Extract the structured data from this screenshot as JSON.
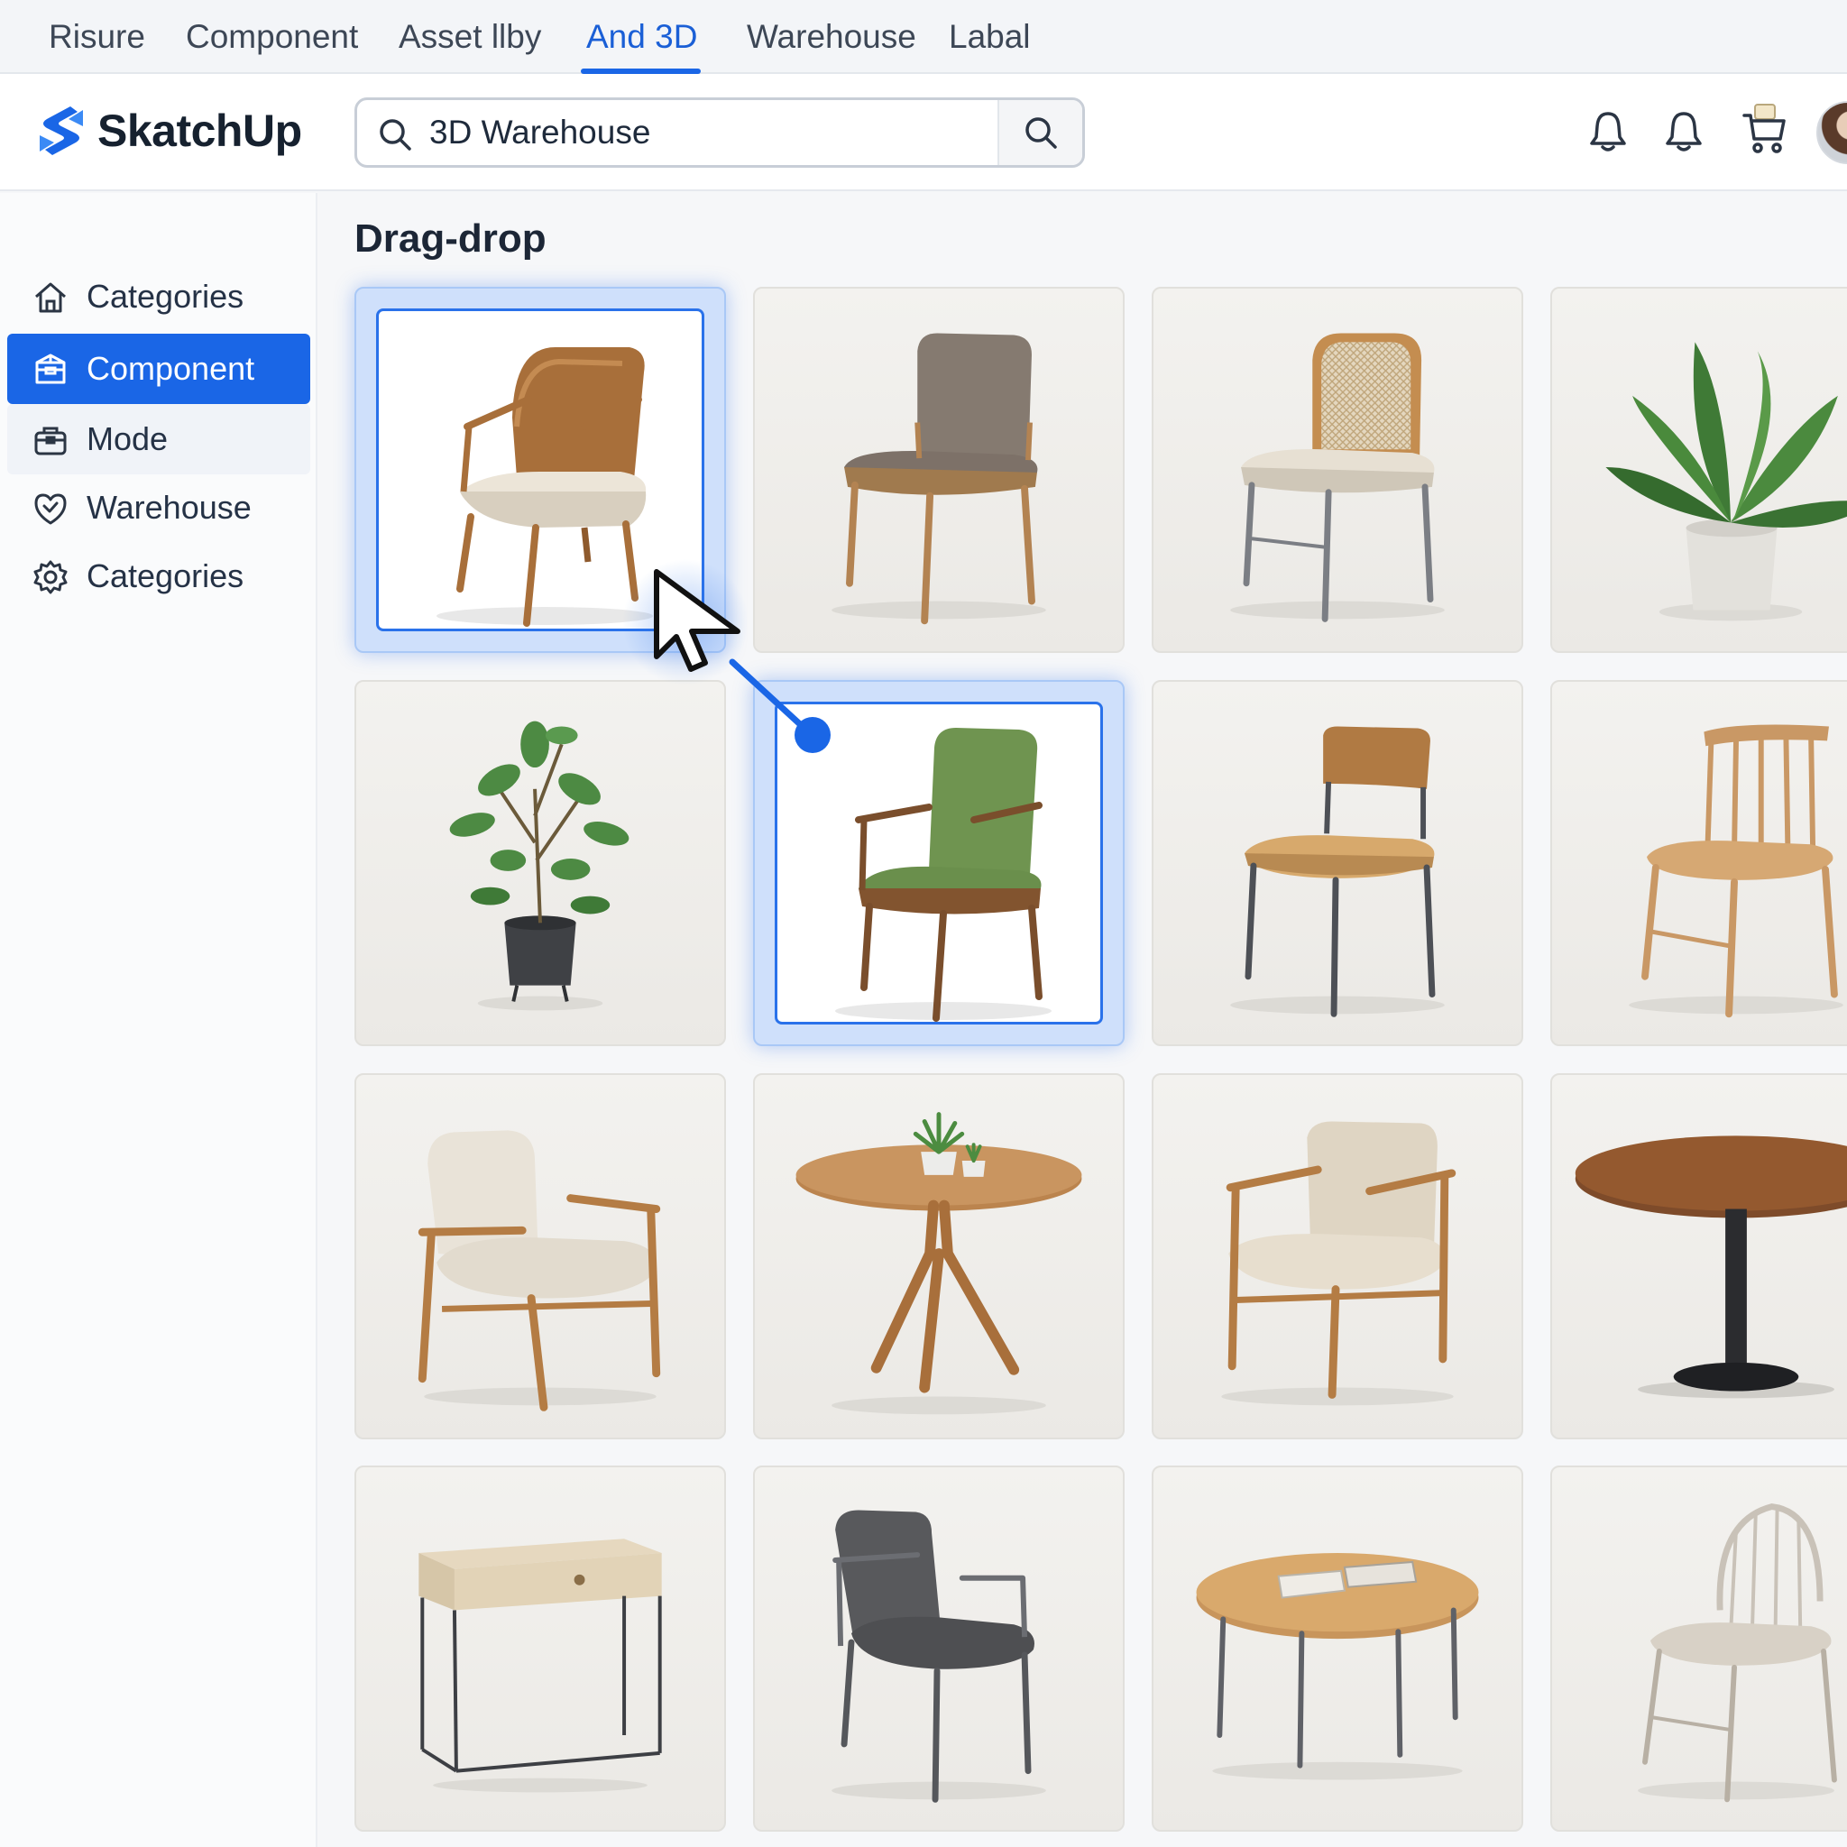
{
  "tabs": [
    {
      "label": "Risure",
      "active": false
    },
    {
      "label": "Component",
      "active": false
    },
    {
      "label": "Asset llby",
      "active": false
    },
    {
      "label": "And 3D",
      "active": true
    },
    {
      "label": "Warehouse",
      "active": false
    },
    {
      "label": "Labal",
      "active": false
    }
  ],
  "brand": {
    "name": "SkatchUp",
    "color": "#1a66e6"
  },
  "search": {
    "value": "3D Warehouse",
    "placeholder": "3D Warehouse"
  },
  "header_icons": [
    "bell-icon",
    "bell-icon",
    "cart-icon",
    "avatar"
  ],
  "sidebar": {
    "items": [
      {
        "label": "Categories",
        "icon": "home-icon",
        "state": "normal"
      },
      {
        "label": "Component",
        "icon": "box-icon",
        "state": "active"
      },
      {
        "label": "Mode",
        "icon": "bag-icon",
        "state": "hover"
      },
      {
        "label": "Warehouse",
        "icon": "heart-badge-icon",
        "state": "normal"
      },
      {
        "label": "Categories",
        "icon": "settings-icon",
        "state": "normal"
      }
    ]
  },
  "main": {
    "title": "Drag-drop",
    "grid": [
      {
        "item": "wood armchair",
        "state": "drag-source"
      },
      {
        "item": "taupe dining chair",
        "state": "normal"
      },
      {
        "item": "rattan chair",
        "state": "normal"
      },
      {
        "item": "potted plant",
        "state": "normal"
      },
      {
        "item": "potted tree",
        "state": "normal"
      },
      {
        "item": "green armchair",
        "state": "drop-target"
      },
      {
        "item": "wood chair metal legs",
        "state": "normal"
      },
      {
        "item": "spindle chair",
        "state": "normal"
      },
      {
        "item": "lounge chair",
        "state": "normal"
      },
      {
        "item": "round table plants",
        "state": "normal"
      },
      {
        "item": "cream lounge chair",
        "state": "normal"
      },
      {
        "item": "pedestal table",
        "state": "normal"
      },
      {
        "item": "side table drawer",
        "state": "normal"
      },
      {
        "item": "grey armchair",
        "state": "normal"
      },
      {
        "item": "coffee table books",
        "state": "normal"
      },
      {
        "item": "windsor chair",
        "state": "normal"
      }
    ]
  },
  "colors": {
    "accent": "#1a66e6",
    "selection": "#cfe0fb"
  }
}
